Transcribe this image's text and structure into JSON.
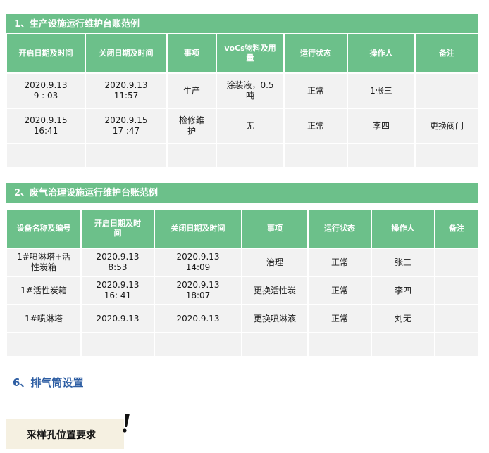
{
  "section1": {
    "title": "1、生产设施运行维护台账范例",
    "headers": [
      "开启日期及时间",
      "关闭日期及时间",
      "事项",
      "voCs物料及用\n量",
      "运行状态",
      "操作人",
      "备注"
    ],
    "rows": [
      [
        "2020.9.13\n9 : 03",
        "2020.9.13\n11:57",
        "生产",
        "涂装液，0.5\n吨",
        "正常",
        "1张三",
        ""
      ],
      [
        "2020.9.15\n16:41",
        "2020.9.15\n17 :47",
        "检修维\n护",
        "无",
        "正常",
        "李四",
        "更换阀门"
      ],
      [
        "",
        "",
        "",
        "",
        "",
        "",
        ""
      ]
    ]
  },
  "section2": {
    "title": "2、废气治理设施运行维护台账范例",
    "headers": [
      "设备名称及编号",
      "开启日期及时\n间",
      "关闭日期及时间",
      "事项",
      "运行状态",
      "操作人",
      "备注"
    ],
    "rows": [
      [
        "1#喷淋塔+活\n性炭箱",
        "2020.9.13\n8:53",
        "2020.9.13\n14:09",
        "治理",
        "正常",
        "张三",
        ""
      ],
      [
        "1#活性炭箱",
        "2020.9.13\n16: 41",
        "2020.9.13\n18:07",
        "更换活性炭",
        "正常",
        "李四",
        ""
      ],
      [
        "1#喷淋塔",
        "2020.9.13",
        "2020.9.13",
        "更换喷淋液",
        "正常",
        "刘无",
        ""
      ],
      [
        "",
        "",
        "",
        "",
        "",
        "",
        ""
      ]
    ]
  },
  "heading6": "6、排气筒设置",
  "callout": {
    "label": "采样孔位置要求",
    "icon": "exclamation-icon"
  },
  "colors": {
    "header_green": "#6cc08a",
    "cell_gray": "#f2f2f2",
    "heading_blue": "#2e5ea3",
    "callout_bg": "#f5f0e1"
  }
}
